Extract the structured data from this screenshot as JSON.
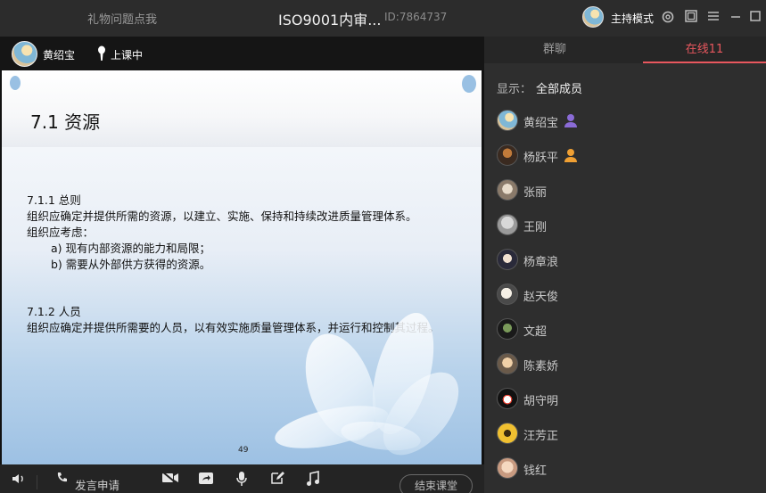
{
  "titlebar": {
    "left_text": "礼物问题点我",
    "title": "ISO9001内审...",
    "id_text": "ID:7864737",
    "mode_label": "主持模式",
    "icons": [
      "gear-icon",
      "window-icon",
      "menu-icon",
      "minimize-icon",
      "maximize-icon",
      "close-icon"
    ]
  },
  "stage": {
    "presenter_name": "黄绍宝",
    "class_status": "上课中"
  },
  "slide": {
    "title": "7.1  资源",
    "lines": [
      "7.1.1  总则",
      "组织应确定并提供所需的资源，以建立、实施、保持和持续改进质量管理体系。",
      "组织应考虑：",
      "a)  现有内部资源的能力和局限；",
      "b)  需要从外部供方获得的资源。",
      "7.1.2  人员",
      "组织应确定并提供所需要的人员，以有效实施质量管理体系，并运行和控制其过程。"
    ],
    "page_number": "49"
  },
  "toolbar": {
    "apply_speak_label": "发言申请",
    "end_class_label": "结束课堂"
  },
  "panel": {
    "tabs": {
      "chat": "群聊",
      "online": "在线11"
    },
    "filter_label": "显示：",
    "filter_value": "全部成员",
    "members": [
      {
        "name": "黄绍宝",
        "badge": "host-badge-icon",
        "badge_color": "#8a6bd6"
      },
      {
        "name": "杨跃平",
        "badge": "teacher-badge-icon",
        "badge_color": "#f0a033"
      },
      {
        "name": "张丽"
      },
      {
        "name": "王刚"
      },
      {
        "name": "杨章浪"
      },
      {
        "name": "赵天俊"
      },
      {
        "name": "文超"
      },
      {
        "name": "陈素娇"
      },
      {
        "name": "胡守明"
      },
      {
        "name": "汪芳正"
      },
      {
        "name": "钱红"
      }
    ]
  },
  "colors": {
    "accent": "#e8575e",
    "panel_bg": "#2e2e2e",
    "titlebar_bg": "#2c2c2c"
  }
}
